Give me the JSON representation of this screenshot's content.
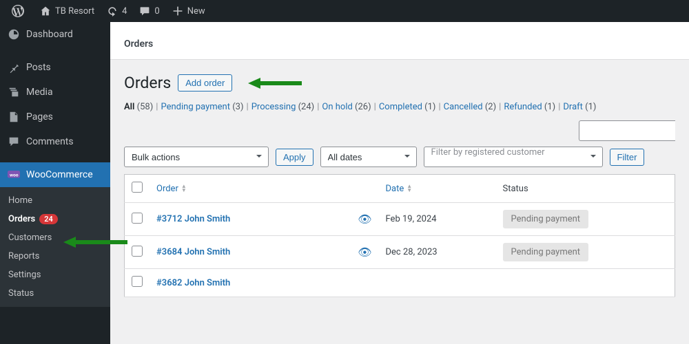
{
  "adminbar": {
    "site_name": "TB Resort",
    "updates": "4",
    "comments": "0",
    "new": "New"
  },
  "sidebar": {
    "items": [
      {
        "label": "Dashboard",
        "icon": "dashboard"
      },
      {
        "label": "Posts",
        "icon": "pin"
      },
      {
        "label": "Media",
        "icon": "media"
      },
      {
        "label": "Pages",
        "icon": "page"
      },
      {
        "label": "Comments",
        "icon": "comment"
      },
      {
        "label": "WooCommerce",
        "icon": "woo"
      }
    ],
    "submenu": [
      {
        "label": "Home"
      },
      {
        "label": "Orders",
        "badge": "24"
      },
      {
        "label": "Customers"
      },
      {
        "label": "Reports"
      },
      {
        "label": "Settings"
      },
      {
        "label": "Status"
      }
    ]
  },
  "header_strip": "Orders",
  "page": {
    "title": "Orders",
    "add_button": "Add order"
  },
  "filters": [
    {
      "label": "All",
      "count": "(58)",
      "current": true
    },
    {
      "label": "Pending payment",
      "count": "(3)"
    },
    {
      "label": "Processing",
      "count": "(24)"
    },
    {
      "label": "On hold",
      "count": "(26)"
    },
    {
      "label": "Completed",
      "count": "(1)"
    },
    {
      "label": "Cancelled",
      "count": "(2)"
    },
    {
      "label": "Refunded",
      "count": "(1)"
    },
    {
      "label": "Draft",
      "count": "(1)"
    }
  ],
  "tablenav": {
    "bulk": "Bulk actions",
    "apply": "Apply",
    "dates": "All dates",
    "customer_placeholder": "Filter by registered customer",
    "filter": "Filter"
  },
  "columns": {
    "order": "Order",
    "date": "Date",
    "status": "Status"
  },
  "rows": [
    {
      "order": "#3712 John Smith",
      "date": "Feb 19, 2024",
      "status": "Pending payment"
    },
    {
      "order": "#3684 John Smith",
      "date": "Dec 28, 2023",
      "status": "Pending payment"
    },
    {
      "order": "#3682 John Smith",
      "date": "",
      "status": ""
    }
  ]
}
